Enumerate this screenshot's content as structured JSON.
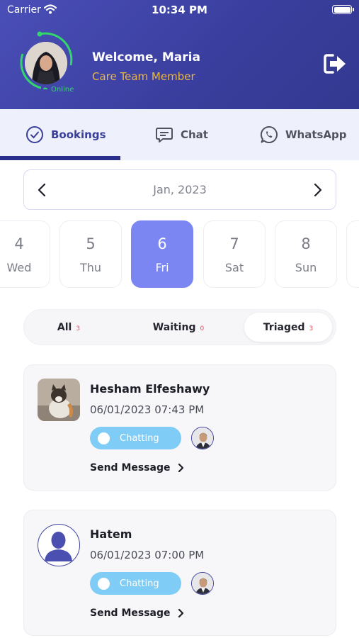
{
  "status_bar": {
    "carrier": "Carrier",
    "time": "10:34 PM"
  },
  "profile": {
    "welcome": "Welcome, Maria",
    "role": "Care Team Member",
    "status": "Online"
  },
  "tabs": [
    {
      "label": "Bookings",
      "icon": "check-circle-icon"
    },
    {
      "label": "Chat",
      "icon": "chat-icon"
    },
    {
      "label": "WhatsApp",
      "icon": "whatsapp-icon"
    }
  ],
  "calendar": {
    "month": "Jan, 2023",
    "days": [
      {
        "num": "4",
        "dow": "Wed"
      },
      {
        "num": "5",
        "dow": "Thu"
      },
      {
        "num": "6",
        "dow": "Fri"
      },
      {
        "num": "7",
        "dow": "Sat"
      },
      {
        "num": "8",
        "dow": "Sun"
      }
    ],
    "selected": "6"
  },
  "filters": [
    {
      "label": "All",
      "count": "3"
    },
    {
      "label": "Waiting",
      "count": "0"
    },
    {
      "label": "Triaged",
      "count": "3"
    }
  ],
  "bookings": [
    {
      "name": "Hesham Elfeshawy",
      "datetime": "06/01/2023 07:43 PM",
      "status": "Chatting",
      "action": "Send Message"
    },
    {
      "name": "Hatem",
      "datetime": "06/01/2023 07:00 PM",
      "status": "Chatting",
      "action": "Send Message"
    }
  ],
  "colors": {
    "header": "#3a3f9f",
    "accent": "#7b86f2",
    "role": "#e8b64a",
    "online": "#33d66a",
    "chatting": "#7fcdf6"
  }
}
